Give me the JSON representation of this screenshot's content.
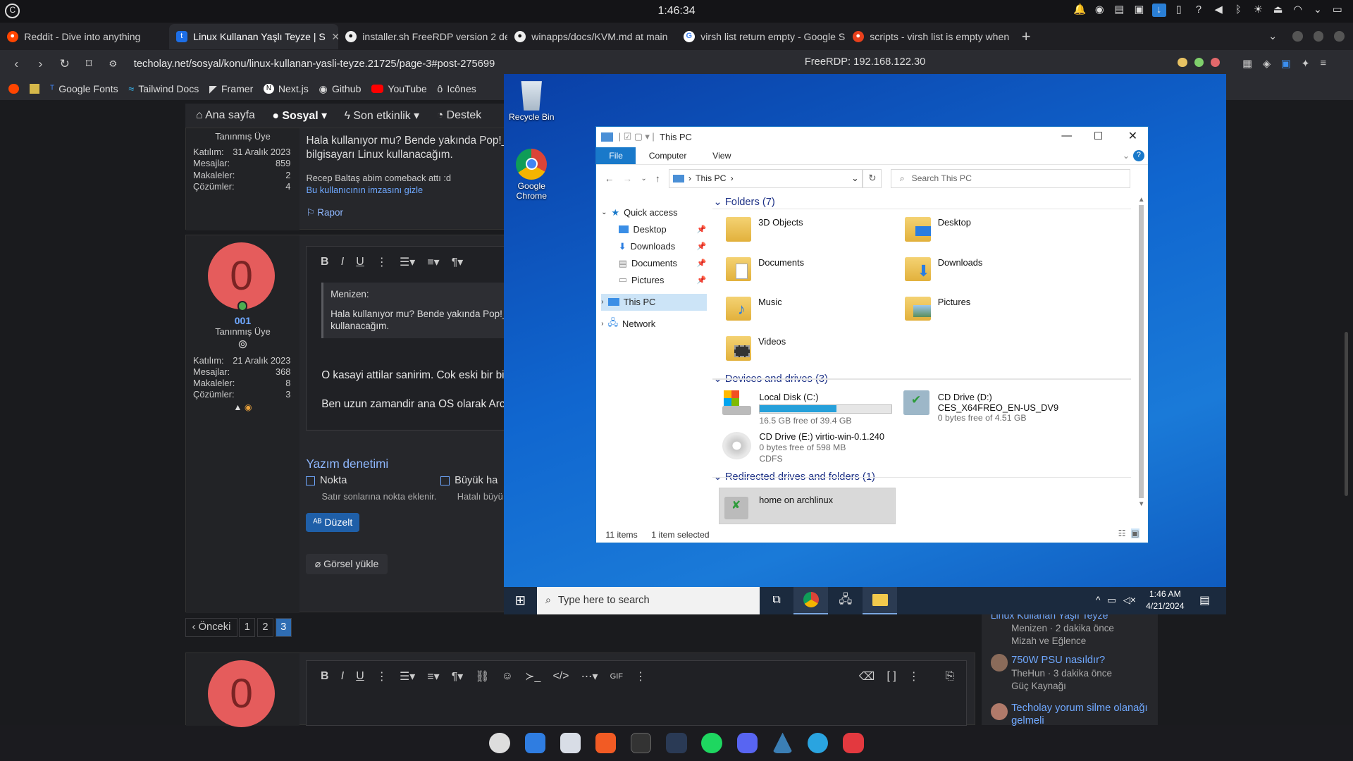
{
  "system": {
    "clock": "1:46:34"
  },
  "browser": {
    "tabs": [
      {
        "label": "Reddit - Dive into anything",
        "color": "#ff4500"
      },
      {
        "label": "Linux Kullanan Yaşlı Teyze | S",
        "color": "#1d6ee6"
      },
      {
        "label": "installer.sh FreeRDP version 2 de",
        "color": "#444"
      },
      {
        "label": "winapps/docs/KVM.md at main",
        "color": "#444"
      },
      {
        "label": "virsh list return empty - Google S",
        "color": "#4285f4"
      },
      {
        "label": "scripts - virsh list is empty when",
        "color": "#e8401c"
      }
    ],
    "url": "techolay.net/sosyal/konu/linux-kullanan-yasli-teyze.21725/page-3#post-275699",
    "bookmarks": [
      "Google Fonts",
      "Tailwind Docs",
      "Framer",
      "Next.js",
      "Github",
      "YouTube",
      "Icônes"
    ]
  },
  "forum": {
    "nav": [
      "Ana sayfa",
      "Sosyal",
      "Son etkinlik",
      "Destek"
    ],
    "post1": {
      "role": "Tanınmış Üye",
      "joined_label": "Katılım:",
      "joined": "31 Aralık 2023",
      "msgs_label": "Mesajlar:",
      "msgs": "859",
      "articles_label": "Makaleler:",
      "articles": "2",
      "solutions_label": "Çözümler:",
      "solutions": "4",
      "text": "Hala kullanıyor mu? Bende yakında Pop!_O",
      "text2": "bilgisayarı Linux kullanacağım.",
      "sig": "Recep Baltaş abim comeback attı :d",
      "hide_sig": "Bu kullanıcının imzasını gizle",
      "report": "Rapor"
    },
    "post2": {
      "avatar": "0",
      "name": "001",
      "role": "Tanınmış Üye",
      "joined": "21 Aralık 2023",
      "msgs": "368",
      "articles": "8",
      "solutions": "3",
      "quote_author": "Menizen:",
      "quote": "Hala kullanıyor mu? Bende yakında Pop!_",
      "quote2": "kullanacağım.",
      "line1": "O kasayi attilar sanirim. Cok eski bir bilg",
      "line2": "Ben uzun zamandir ana OS olarak Arch"
    },
    "spell": {
      "title": "Yazım denetimi",
      "opt1": "Nokta",
      "opt1_desc": "Satır sonlarına nokta eklenir.",
      "opt2": "Büyük ha",
      "opt2_desc": "Hatalı büyü",
      "fix": "Düzelt",
      "upload": "Görsel yükle"
    },
    "pagination": {
      "prev": "Önceki",
      "pages": [
        "1",
        "2",
        "3"
      ],
      "current": "3"
    },
    "reply_avatar": "0",
    "sidebar": [
      {
        "title": "Linux Kullanan Yaşlı Teyze",
        "meta": "Menizen · 2 dakika önce",
        "cat": "Mizah ve Eğlence"
      },
      {
        "title": "750W PSU nasıldır?",
        "meta": "TheHun · 3 dakika önce",
        "cat": "Güç Kaynağı"
      },
      {
        "title": "Techolay yorum silme olanağı",
        "meta": "gelmeli",
        "cat": ""
      }
    ]
  },
  "rdp": {
    "title": "FreeRDP: 192.168.122.30",
    "desktop_icons": [
      "Recycle Bin",
      "Google Chrome"
    ],
    "explorer": {
      "title": "This PC",
      "ribbon": [
        "File",
        "Computer",
        "View"
      ],
      "path": "This PC",
      "search_placeholder": "Search This PC",
      "nav": {
        "quick_access": "Quick access",
        "items": [
          "Desktop",
          "Downloads",
          "Documents",
          "Pictures"
        ],
        "this_pc": "This PC",
        "network": "Network"
      },
      "folders_header": "Folders (7)",
      "folders": [
        "3D Objects",
        "Desktop",
        "Documents",
        "Downloads",
        "Music",
        "Pictures",
        "Videos"
      ],
      "devices_header": "Devices and drives (3)",
      "drive_c": {
        "name": "Local Disk (C:)",
        "free": "16.5 GB free of 39.4 GB",
        "used_fraction": 0.58
      },
      "drive_d": {
        "name": "CD Drive (D:)",
        "label": "CES_X64FREO_EN-US_DV9",
        "free": "0 bytes free of 4.51 GB"
      },
      "drive_e": {
        "name": "CD Drive (E:) virtio-win-0.1.240",
        "free": "0 bytes free of 598 MB",
        "fs": "CDFS"
      },
      "redirected_header": "Redirected drives and folders (1)",
      "redirected": "home on archlinux",
      "status_items": "11 items",
      "status_selected": "1 item selected"
    },
    "taskbar": {
      "search": "Type here to search",
      "time": "1:46 AM",
      "date": "4/21/2024"
    }
  },
  "colors": {
    "accent": "#1979ca",
    "avatar": "#e55c5c",
    "page_bg": "#1a1b1e"
  }
}
